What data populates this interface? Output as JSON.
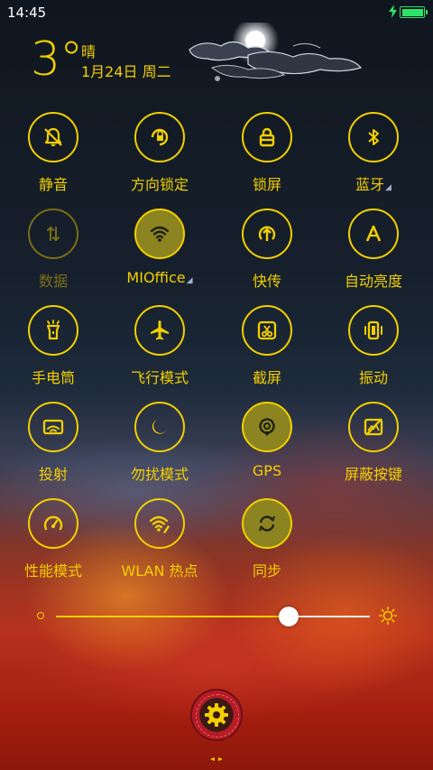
{
  "status_bar": {
    "time": "14:45",
    "charging_icon": "charging-bolt-icon",
    "battery_icon": "battery-full-icon"
  },
  "weather": {
    "temperature": "3°",
    "condition": "晴",
    "date": "1月24日 周二",
    "art_icon": "moon-clouds-icon"
  },
  "toggles": [
    {
      "label": "静音",
      "icon": "bell-mute-icon",
      "state": "off"
    },
    {
      "label": "方向锁定",
      "icon": "rotation-lock-icon",
      "state": "off"
    },
    {
      "label": "锁屏",
      "icon": "lock-icon",
      "state": "off"
    },
    {
      "label": "蓝牙",
      "icon": "bluetooth-icon",
      "state": "off",
      "expandable": true
    },
    {
      "label": "数据",
      "icon": "mobile-data-icon",
      "state": "disabled"
    },
    {
      "label": "MIOffice",
      "icon": "wifi-icon",
      "state": "on",
      "expandable": true
    },
    {
      "label": "快传",
      "icon": "share-transfer-icon",
      "state": "off"
    },
    {
      "label": "自动亮度",
      "icon": "auto-brightness-icon",
      "state": "off"
    },
    {
      "label": "手电筒",
      "icon": "flashlight-icon",
      "state": "off"
    },
    {
      "label": "飞行模式",
      "icon": "airplane-icon",
      "state": "off"
    },
    {
      "label": "截屏",
      "icon": "screenshot-icon",
      "state": "off"
    },
    {
      "label": "振动",
      "icon": "vibrate-icon",
      "state": "off"
    },
    {
      "label": "投射",
      "icon": "cast-icon",
      "state": "off"
    },
    {
      "label": "勿扰模式",
      "icon": "moon-icon",
      "state": "off"
    },
    {
      "label": "GPS",
      "icon": "location-icon",
      "state": "on"
    },
    {
      "label": "屏蔽按键",
      "icon": "keys-blocked-icon",
      "state": "off"
    },
    {
      "label": "性能模式",
      "icon": "speedometer-icon",
      "state": "off"
    },
    {
      "label": "WLAN 热点",
      "icon": "hotspot-icon",
      "state": "off"
    },
    {
      "label": "同步",
      "icon": "sync-icon",
      "state": "on"
    }
  ],
  "brightness": {
    "level": 0.74,
    "low_icon": "brightness-low-icon",
    "high_icon": "brightness-high-icon"
  },
  "settings": {
    "icon": "gear-icon"
  },
  "colors": {
    "accent": "#f3cf00",
    "active_fill": "#8c8420",
    "battery": "#2ee36a",
    "settings_red": "#b61c26"
  }
}
